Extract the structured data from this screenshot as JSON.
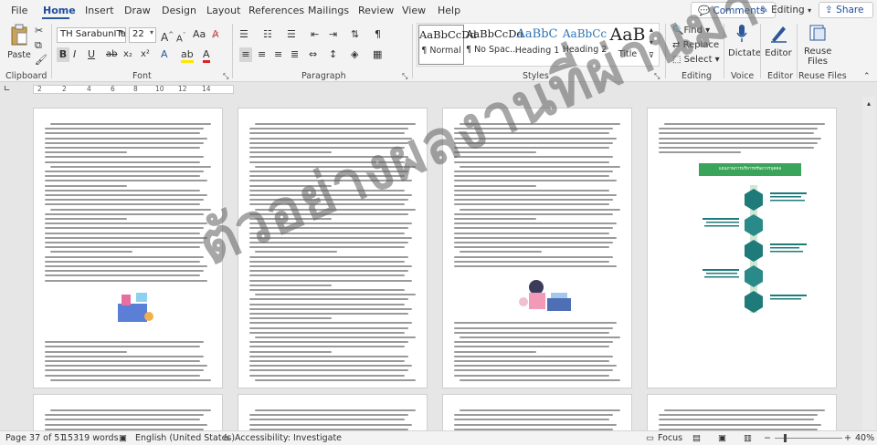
{
  "tabs": [
    "File",
    "Home",
    "Insert",
    "Draw",
    "Design",
    "Layout",
    "References",
    "Mailings",
    "Review",
    "View",
    "Help"
  ],
  "active_tab": "Home",
  "top_buttons": {
    "comments": "Comments",
    "editing": "Editing",
    "share": "Share"
  },
  "clipboard": {
    "paste": "Paste",
    "group": "Clipboard"
  },
  "font": {
    "name": "TH SarabunITas",
    "size": "22",
    "group": "Font",
    "grow": "A",
    "shrink": "A",
    "change_case": "Aa",
    "bold": "B",
    "italic": "I",
    "underline": "U",
    "strike": "ab",
    "subscript": "x₂",
    "superscript": "x²"
  },
  "paragraph": {
    "group": "Paragraph"
  },
  "styles": {
    "group": "Styles",
    "items": [
      {
        "preview": "AaBbCcDd",
        "name": "¶ Normal"
      },
      {
        "preview": "AaBbCcDd",
        "name": "¶ No Spac..."
      },
      {
        "preview": "AaBbC",
        "name": "Heading 1"
      },
      {
        "preview": "AaBbCc",
        "name": "Heading 2"
      },
      {
        "preview": "AaB",
        "name": "Title"
      }
    ]
  },
  "editing": {
    "group": "Editing",
    "find": "Find",
    "replace": "Replace",
    "select": "Select"
  },
  "voice": {
    "group": "Voice",
    "dictate": "Dictate"
  },
  "editor": {
    "group": "Editor",
    "label": "Editor"
  },
  "reuse": {
    "group": "Reuse Files",
    "label1": "Reuse",
    "label2": "Files"
  },
  "ruler": {
    "numbers": [
      "2",
      "2",
      "4",
      "6",
      "8",
      "10",
      "12",
      "14"
    ]
  },
  "document": {
    "watermark": "ตัวอย่างผลงานที่ผ่านมา",
    "infographic_header": "แผนภาพการบริหารทรัพยากรบุคคล"
  },
  "status": {
    "page": "Page 37 of 51",
    "words": "15319 words",
    "language": "English (United States)",
    "accessibility": "Accessibility: Investigate",
    "focus": "Focus",
    "zoom": "40%"
  },
  "colors": {
    "accent": "#2b579a",
    "infographic_green": "#3aa55a",
    "infographic_teal": "#1f7a7a"
  }
}
